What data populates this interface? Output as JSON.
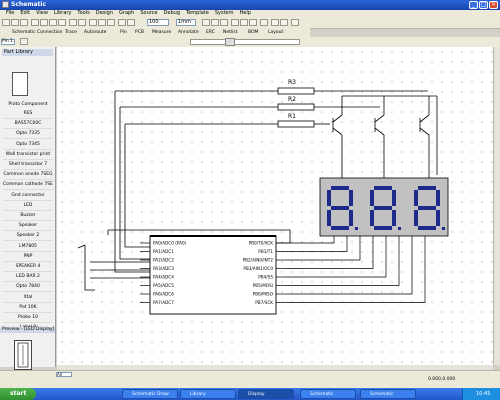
{
  "window": {
    "title": "Schematic"
  },
  "menu": [
    "File",
    "Edit",
    "View",
    "Library",
    "Tools",
    "Design",
    "Graph",
    "Source",
    "Debug",
    "Template",
    "System",
    "Help"
  ],
  "toolbar": {
    "zoom_value": "100",
    "units_value": "1mm",
    "buttons": [
      "Schematic",
      "Connection",
      "Trace",
      "Autoroute",
      "Pin",
      "PCB",
      "Measure",
      "Annotate",
      "ERC",
      "Netlist",
      "BOM",
      "Layout"
    ]
  },
  "sidebar": {
    "header": "Part Library",
    "part_name": "Proto Component",
    "style_value": "Pin 1",
    "parts": [
      "RES",
      "BAS57C00C",
      "Opto 7335",
      "Opto 7345",
      "Wall transistor print",
      "Shell transistor 7",
      "Common anode 7SEG",
      "Common cathode 7SEG",
      "Gnd connector",
      "LED",
      "Buzzer",
      "Speaker",
      "Speaker 2",
      "LM7805",
      "PNP",
      "SPEAKER 4",
      "LED BAR 2",
      "Opto 7840",
      "Xtal",
      "Pot 10K",
      "Probe 10",
      "Label 8"
    ],
    "preview_header": "Preview - [LED Display]"
  },
  "schematic": {
    "resistors": [
      "R3",
      "R2",
      "R1"
    ],
    "display_digits": [
      "8",
      "8",
      "8"
    ],
    "ic_labels_left": [
      "PA0/ADC0 (PA0)",
      "PA1/ADC1",
      "PA2/ADC2",
      "PA3/ADC3",
      "PA4/ADC4",
      "PA5/ADC5",
      "PA6/ADC6",
      "PA7/ADC7"
    ],
    "ic_labels_right": [
      "PB0/T0/XCK",
      "PB1/T1",
      "PB2/AIN0/INT2",
      "PB3/AIN1/OC0",
      "PB4/SS",
      "PB5/MOSI",
      "PB6/MISO",
      "PB7/SCK"
    ]
  },
  "status": {
    "zoom_select": "All",
    "coords": "0.000,0.000"
  },
  "taskbar": {
    "start": "start",
    "tasks": [
      "Schematic Draw",
      "Library",
      "Display",
      "Schematic",
      "Schematic"
    ],
    "clock": "10:45"
  }
}
